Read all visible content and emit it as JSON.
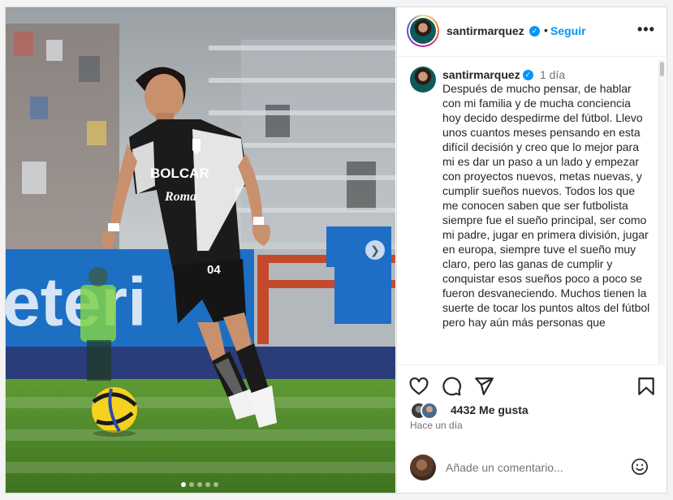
{
  "post": {
    "username": "santirmarquez",
    "follow_label": "Seguir",
    "time_ago": "1 día",
    "caption": "Después de mucho pensar, de hablar con mi familia y de mucha conciencia hoy decido despedirme del fútbol. Llevo unos cuantos meses pensando en esta difícil decisión y creo que lo mejor para mi es dar un paso a un lado y empezar con proyectos nuevos, metas nuevas, y cumplir sueños nuevos. Todos los que me conocen saben que ser futbolista siempre fue el sueño principal, ser como mi padre, jugar en primera división, jugar en europa, siempre tuve el sueño muy claro, pero las ganas de cumplir y conquistar esos sueños poco a poco se fueron desvaneciendo. Muchos tienen la suerte de tocar los puntos altos del fútbol pero hay aún más personas que",
    "likes_text": "4432 Me gusta",
    "posted_ago": "Hace un día",
    "comment_placeholder": "Añade un comentario...",
    "carousel_total": 5,
    "carousel_current": 1
  },
  "photo": {
    "sponsor_front": "BOLCAR",
    "sponsor_lower": "Roma",
    "shirt_number": "04"
  },
  "colors": {
    "accent": "#0095f6",
    "text": "#262626",
    "muted": "#737373",
    "grass": "#4f8a2a",
    "banner": "#1d6fc4"
  },
  "icons": [
    "verified-icon",
    "more-icon",
    "heart-icon",
    "comment-icon",
    "share-icon",
    "bookmark-icon",
    "emoji-icon",
    "chevron-right-icon"
  ]
}
